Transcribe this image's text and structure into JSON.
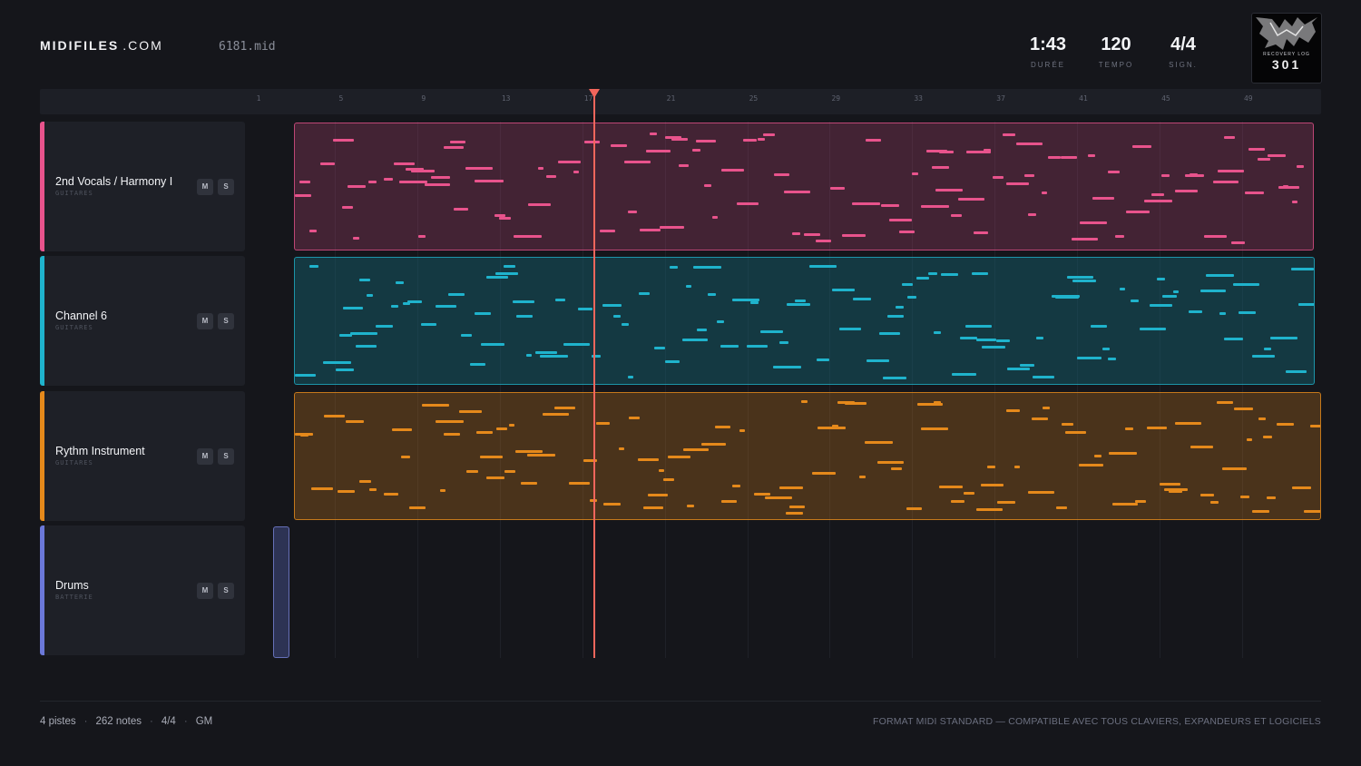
{
  "header": {
    "logo_bold": "MIDIFILES",
    "logo_domain": ".COM",
    "filename": "6181.mid",
    "stats": [
      {
        "value": "1:43",
        "label": "DURÉE"
      },
      {
        "value": "120",
        "label": "TEMPO"
      },
      {
        "value": "4/4",
        "label": "SIGN."
      }
    ],
    "cover": {
      "caption": "RECOVERY LOG",
      "big": "301"
    }
  },
  "ruler": {
    "bars": [
      "1",
      "5",
      "9",
      "13",
      "17",
      "21",
      "25",
      "29",
      "33",
      "37",
      "41",
      "45",
      "49"
    ],
    "playhead_bar": 17.2
  },
  "tracks": [
    {
      "name": "2nd Vocals / Harmony I",
      "category": "GUITARES",
      "color": "#e8538c",
      "mute": "M",
      "solo": "S"
    },
    {
      "name": "Channel 6",
      "category": "GUITARES",
      "color": "#1fb3cc",
      "mute": "M",
      "solo": "S"
    },
    {
      "name": "Rythm Instrument",
      "category": "GUITARES",
      "color": "#e5891b",
      "mute": "M",
      "solo": "S"
    },
    {
      "name": "Drums",
      "category": "BATTERIE",
      "color": "#6b78d9",
      "mute": "M",
      "solo": "S"
    }
  ],
  "footer": {
    "tracks": "4 pistes",
    "notes": "262 notes",
    "signature": "4/4",
    "standard": "GM",
    "right": "FORMAT MIDI STANDARD — COMPATIBLE AVEC TOUS CLAVIERS, EXPANDEURS ET LOGICIELS"
  },
  "colors": {
    "background": "#15161b",
    "panel": "#1e2027",
    "playhead": "#f2665c"
  }
}
